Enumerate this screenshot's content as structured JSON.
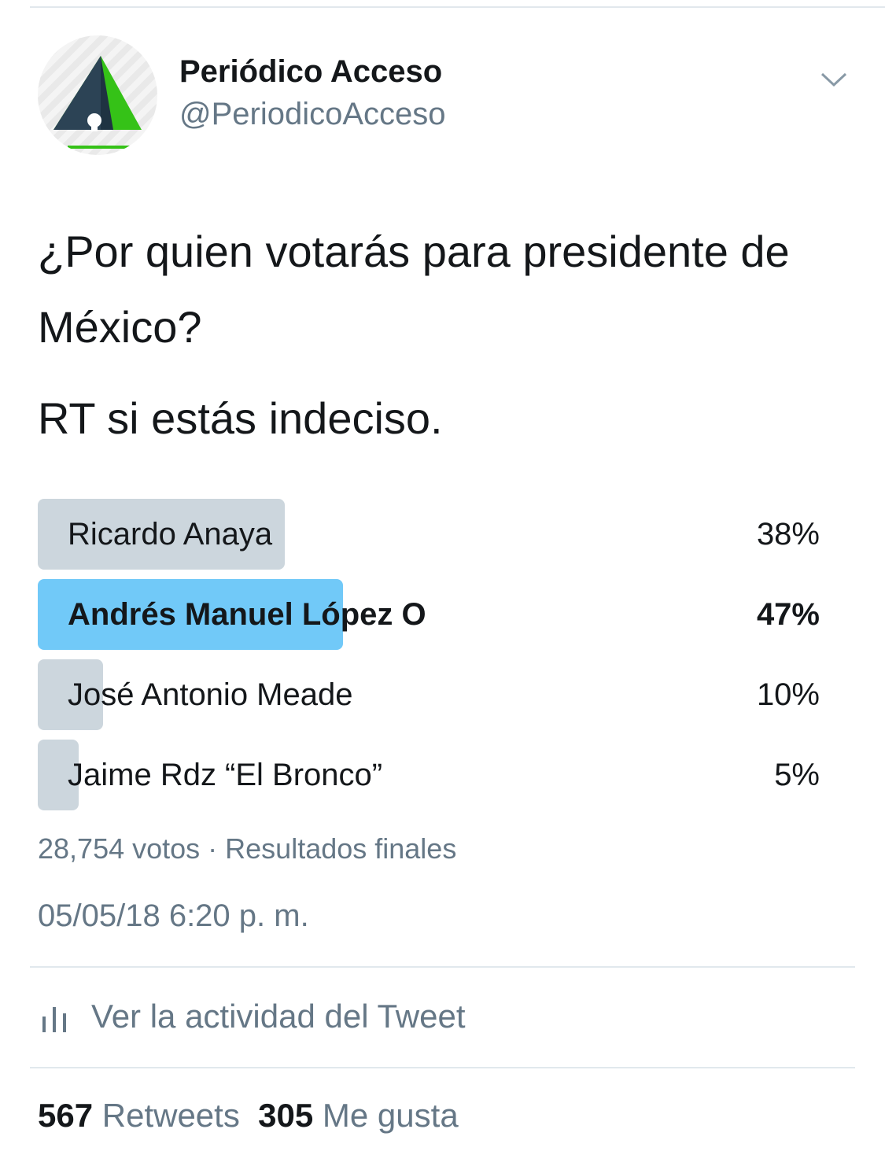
{
  "author": {
    "display_name": "Periódico Acceso",
    "handle": "@PeriodicoAcceso"
  },
  "tweet": {
    "lines": [
      "¿Por quien votarás para presidente de México?",
      "RT si estás indeciso."
    ]
  },
  "poll": {
    "options": [
      {
        "label": "Ricardo Anaya",
        "percent_text": "38%",
        "percent": 38,
        "winner": false
      },
      {
        "label": "Andrés Manuel López O",
        "percent_text": "47%",
        "percent": 47,
        "winner": true
      },
      {
        "label": "José Antonio Meade",
        "percent_text": "10%",
        "percent": 10,
        "winner": false
      },
      {
        "label": "Jaime Rdz  “El Bronco”",
        "percent_text": "5%",
        "percent": 5,
        "winner": false
      }
    ],
    "meta": "28,754 votos · Resultados finales"
  },
  "timestamp": "05/05/18 6:20 p. m.",
  "activity": {
    "label": "Ver la actividad del Tweet",
    "icon": "bar-chart-icon"
  },
  "stats": {
    "retweets_count": "567",
    "retweets_label": "Retweets",
    "likes_count": "305",
    "likes_label": "Me gusta"
  },
  "colors": {
    "poll_bar": "#ccd6dd",
    "poll_bar_winner": "#71c9f8",
    "secondary_text": "#657786",
    "primary_text": "#14171a"
  }
}
